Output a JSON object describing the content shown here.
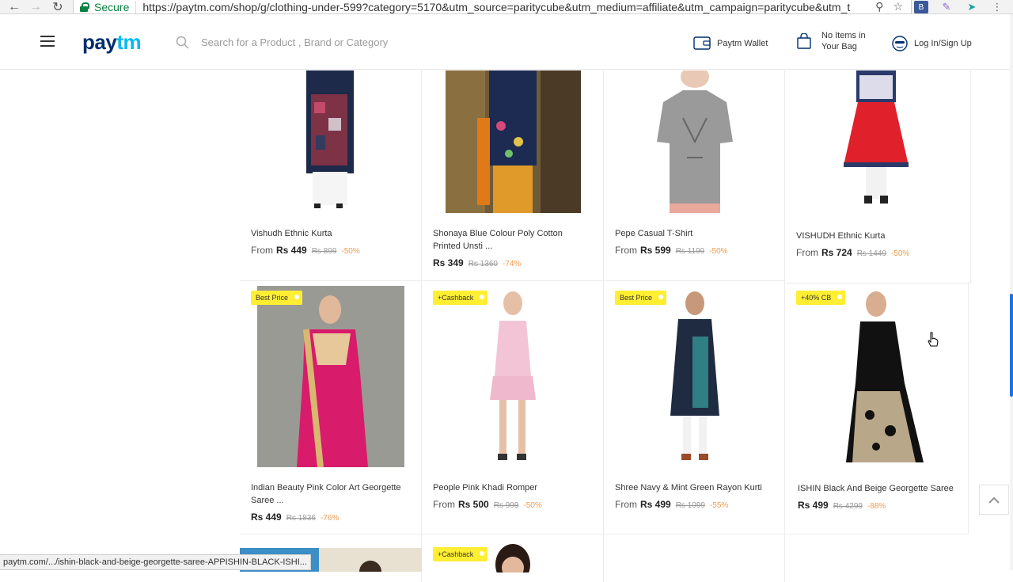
{
  "browser": {
    "secure_label": "Secure",
    "url": "https://paytm.com/shop/g/clothing-under-599?category=5170&utm_source=paritycube&utm_medium=affiliate&utm_campaign=paritycube&utm_t",
    "status_url": "paytm.com/.../ishin-black-and-beige-georgette-saree-APPISHIN-BLACK-ISHI..."
  },
  "header": {
    "logo_pay": "pay",
    "logo_tm": "tm",
    "search_placeholder": "Search for a Product , Brand or Category",
    "wallet_label": "Paytm Wallet",
    "bag_line1": "No Items in",
    "bag_line2": "Your Bag",
    "login_label": "Log In/Sign Up"
  },
  "products": [
    {
      "name": "Vishudh Ethnic Kurta",
      "from": "From",
      "price": "Rs 449",
      "mrp": "Rs 899",
      "discount": "-50%"
    },
    {
      "name": "Shonaya Blue Colour Poly Cotton Printed Unsti ...",
      "from": "",
      "price": "Rs 349",
      "mrp": "Rs 1360",
      "discount": "-74%"
    },
    {
      "name": "Pepe Casual T-Shirt",
      "from": "From",
      "price": "Rs 599",
      "mrp": "Rs 1199",
      "discount": "-50%"
    },
    {
      "name": "VISHUDH Ethnic Kurta",
      "from": "From",
      "price": "Rs 724",
      "mrp": "Rs 1449",
      "discount": "-50%"
    },
    {
      "name": "Indian Beauty Pink Color Art Georgette Saree ...",
      "from": "",
      "price": "Rs 449",
      "mrp": "Rs 1836",
      "discount": "-76%",
      "badge": "Best Price"
    },
    {
      "name": "People Pink Khadi Romper",
      "from": "From",
      "price": "Rs 500",
      "mrp": "Rs 999",
      "discount": "-50%",
      "badge": "+Cashback"
    },
    {
      "name": "Shree Navy & Mint Green Rayon Kurti",
      "from": "From",
      "price": "Rs 499",
      "mrp": "Rs 1099",
      "discount": "-55%",
      "badge": "Best Price"
    },
    {
      "name": "ISHIN Black And Beige Georgette Saree",
      "from": "",
      "price": "Rs 499",
      "mrp": "Rs 4299",
      "discount": "-88%",
      "badge": "+40% CB"
    },
    {
      "badge": "+Cashback"
    }
  ],
  "colors": {
    "brand_dark": "#002e6e",
    "brand_light": "#00baf2",
    "discount": "#f3994d",
    "badge": "#ffee32"
  }
}
